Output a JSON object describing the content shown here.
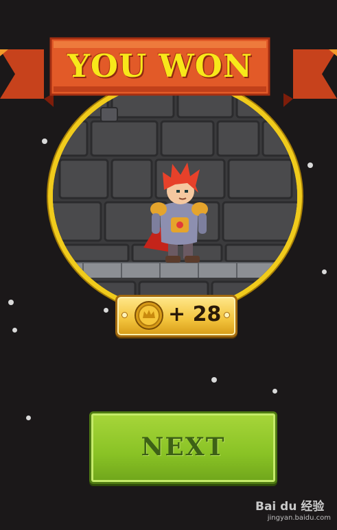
{
  "banner": {
    "title": "YOU WON"
  },
  "reward": {
    "text": "+ 28",
    "icon": "coin-icon",
    "color_plate": "#f2c33c"
  },
  "buttons": {
    "next_label": "NEXT"
  },
  "watermark": {
    "logo": "Bai du 经验",
    "url": "jingyan.baidu.com"
  },
  "colors": {
    "ribbon": "#e25a28",
    "title": "#f8e81a",
    "frame": "#f0cb1c",
    "next_button": "#89c225",
    "background": "#1b1819"
  }
}
